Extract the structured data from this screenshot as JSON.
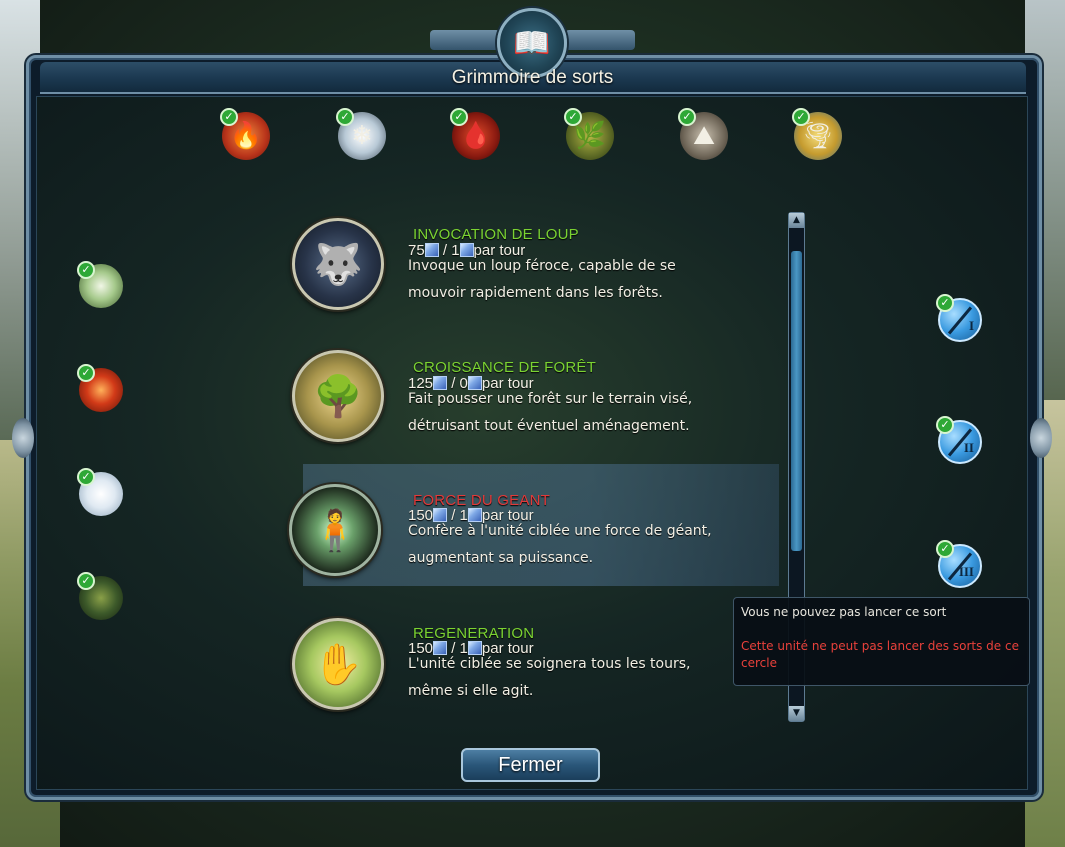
{
  "window": {
    "title": "Grimmoire de sorts",
    "close_label": "Fermer"
  },
  "schools": [
    {
      "name": "fire-school-icon",
      "color": "#d9512a",
      "checked": true
    },
    {
      "name": "ice-school-icon",
      "color": "#c8d6e0",
      "checked": true
    },
    {
      "name": "blood-school-icon",
      "color": "#b5261c",
      "checked": true
    },
    {
      "name": "nature-school-icon",
      "color": "#6d7a2a",
      "checked": true
    },
    {
      "name": "earth-school-icon",
      "color": "#8a8374",
      "checked": true
    },
    {
      "name": "air-school-icon",
      "color": "#c9a440",
      "checked": true
    }
  ],
  "left_icons": [
    {
      "name": "spirit-circle-icon",
      "color": "#c9e3b8"
    },
    {
      "name": "fire-circle-icon",
      "color": "#d23a18"
    },
    {
      "name": "frost-circle-icon",
      "color": "#e6eef5"
    },
    {
      "name": "forest-circle-icon",
      "color": "#3d5a2a"
    }
  ],
  "tiers": [
    {
      "label": "I"
    },
    {
      "label": "II"
    },
    {
      "label": "III"
    }
  ],
  "spells": [
    {
      "name": "INVOCATION DE LOUP",
      "cost": "75",
      "upkeep": "1",
      "per_turn": "par tour",
      "desc1": "Invoque un loup féroce, capable de se",
      "desc2": "mouvoir rapidement dans les forêts.",
      "color": "#7bd332",
      "icon": "wolf-icon"
    },
    {
      "name": "CROISSANCE DE FORÊT",
      "cost": "125",
      "upkeep": "0",
      "per_turn": "par tour",
      "desc1": "Fait pousser une forêt sur le terrain visé,",
      "desc2": "détruisant tout éventuel aménagement.",
      "color": "#7bd332",
      "icon": "tree-icon"
    },
    {
      "name": "FORCE DU GEANT",
      "cost": "150",
      "upkeep": "1",
      "per_turn": "par tour",
      "desc1": "Confère à l'unité ciblée une force de géant,",
      "desc2": "augmentant sa puissance.",
      "color": "#e13a3a",
      "icon": "giant-icon"
    },
    {
      "name": "REGENERATION",
      "cost": "150",
      "upkeep": "1",
      "per_turn": "par tour",
      "desc1": "L'unité ciblée se soignera tous les tours,",
      "desc2": "même si elle agit.",
      "color": "#7bd332",
      "icon": "regen-hand-icon"
    }
  ],
  "tooltip": {
    "line1": "Vous ne pouvez pas lancer ce sort",
    "line2": "Cette unité ne peut pas lancer des sorts de ce cercle"
  },
  "scroll": {
    "up": "▲",
    "down": "▼"
  }
}
